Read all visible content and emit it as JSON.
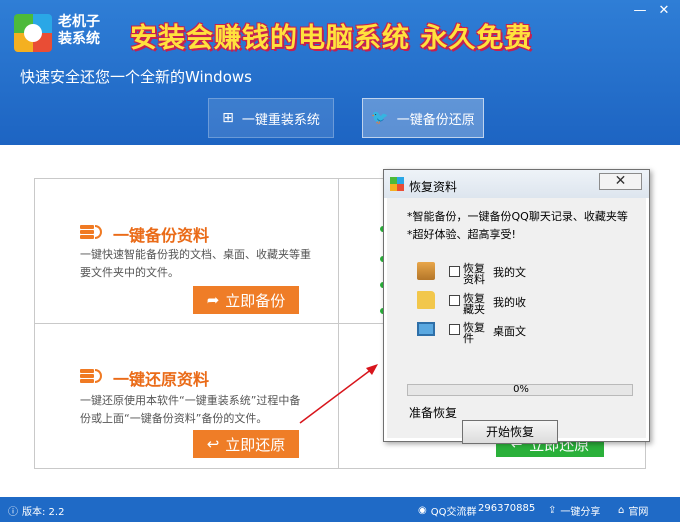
{
  "app": {
    "name_line1": "老机子",
    "name_line2": "装系统",
    "slogan": "安装会赚钱的电脑系统 永久免费",
    "subtitle": "快速安全还您一个全新的Windows",
    "min_glyph": "—",
    "close_glyph": "✕"
  },
  "tabs": [
    {
      "label": "一键重装系统",
      "icon": "windows-icon"
    },
    {
      "label": "一键备份还原",
      "icon": "bird-icon",
      "active": true
    }
  ],
  "sections": {
    "backup": {
      "title": "一键备份资料",
      "desc": "一键快速智能备份我的文档、桌面、收藏夹等重要文件夹中的文件。",
      "button": "立即备份"
    },
    "restore": {
      "title": "一键还原资料",
      "desc": "一键还原使用本软件“一键重装系统”过程中备份或上面“一键备份资料”备份的文件。",
      "button": "立即还原"
    },
    "right_button": "立即还原"
  },
  "dialog": {
    "title": "恢复资料",
    "close_glyph": "✕",
    "line1": "*智能备份，一键备份QQ聊天记录、收藏夹等",
    "line2": "*超好体验、超高享受!",
    "rows": [
      {
        "label": "恢复资料",
        "target": "我的文",
        "icon": "contacts-icon"
      },
      {
        "label": "恢复藏夹",
        "target": "我的收",
        "icon": "folder-icon"
      },
      {
        "label": "恢复件",
        "target": "桌面文",
        "icon": "desktop-icon"
      }
    ],
    "progress": 0,
    "progress_text": "0%",
    "status": "准备恢复",
    "start_button": "开始恢复"
  },
  "footer": {
    "version": "版本: 2.2",
    "qq_group": "QQ交流群",
    "qq_number": "296370885",
    "share": "一键分享",
    "website": "官网"
  },
  "colors": {
    "header_blue": "#1d64c2",
    "accent_orange": "#ef7d27",
    "accent_green": "#2ab03a",
    "slogan_yellow": "#ffe23d"
  }
}
